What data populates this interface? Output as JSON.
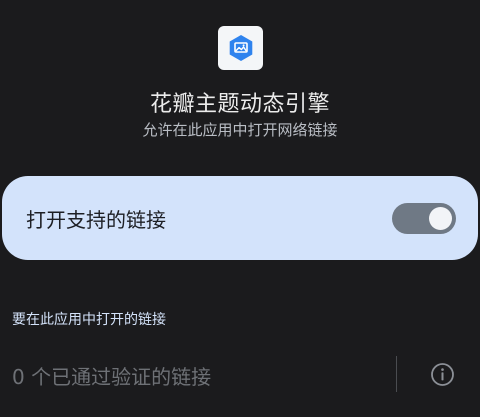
{
  "app": {
    "name": "花瓣主题动态引擎",
    "subtitle": "允许在此应用中打开网络链接",
    "icon": "app-logo-icon"
  },
  "toggle": {
    "label": "打开支持的链接",
    "state": "on"
  },
  "links_section": {
    "heading": "要在此应用中打开的链接",
    "verified_text": "0 个已通过验证的链接",
    "info_icon": "info-icon"
  },
  "colors": {
    "background": "#1b1b1d",
    "card": "#d3e3fb",
    "switch_track": "#6f7985",
    "switch_thumb": "#f2f4f7",
    "accent_heading": "#d4e3fa",
    "app_icon_blue": "#2f83ee"
  }
}
